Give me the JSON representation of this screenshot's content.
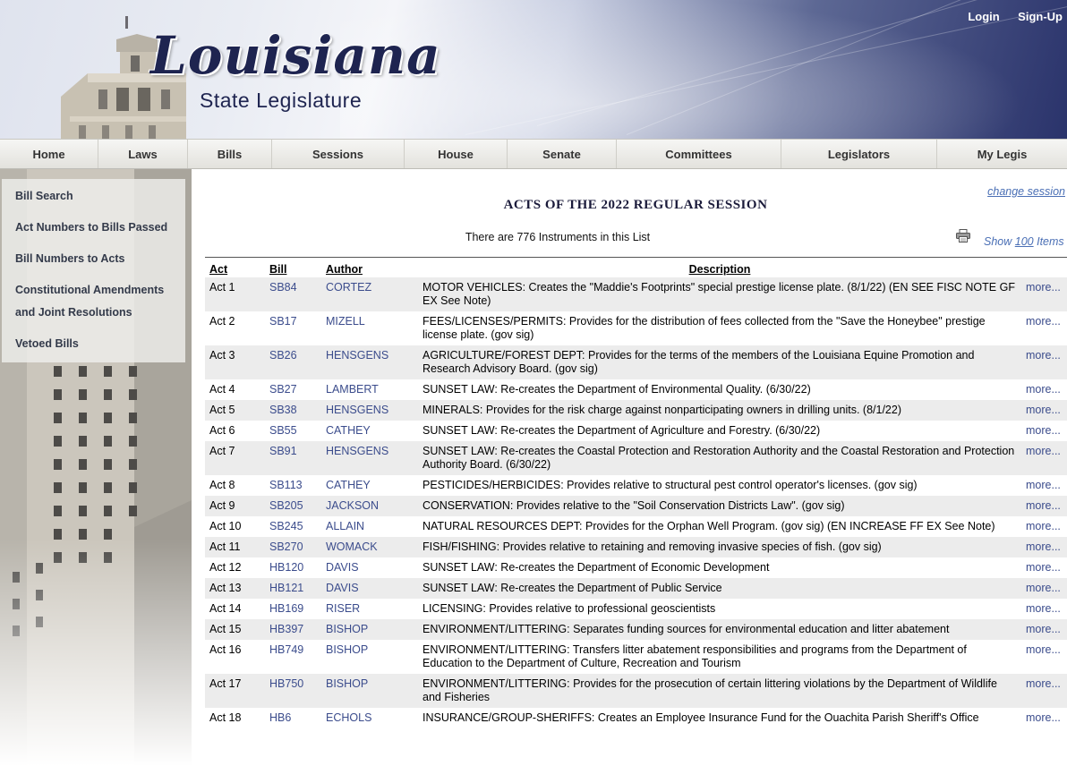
{
  "header": {
    "logo_script": "Louisiana",
    "logo_sub": "State Legislature",
    "login_label": "Login",
    "signup_label": "Sign-Up"
  },
  "nav": {
    "items": [
      "Home",
      "Laws",
      "Bills",
      "Sessions",
      "House",
      "Senate",
      "Committees",
      "Legislators",
      "My Legis"
    ]
  },
  "sidebar": {
    "items": [
      "Bill Search",
      "Act Numbers to Bills Passed",
      "Bill Numbers to Acts",
      "Constitutional Amendments",
      "and Joint Resolutions",
      "Vetoed Bills"
    ]
  },
  "main": {
    "change_session": "change session",
    "title": "ACTS OF THE 2022 REGULAR SESSION",
    "count_text": "There are 776 Instruments in this List",
    "show_prefix": "Show",
    "show_count": "100",
    "show_suffix": "Items",
    "print_icon": "printer-icon"
  },
  "table": {
    "headers": [
      "Act",
      "Bill",
      "Author",
      "Description"
    ],
    "more_label": "more...",
    "rows": [
      {
        "act": "Act 1",
        "bill": "SB84",
        "author": "CORTEZ",
        "desc": "MOTOR VEHICLES:  Creates the \"Maddie's Footprints\" special prestige license plate. (8/1/22) (EN SEE FISC NOTE GF EX See Note)"
      },
      {
        "act": "Act 2",
        "bill": "SB17",
        "author": "MIZELL",
        "desc": "FEES/LICENSES/PERMITS:  Provides for the distribution of fees collected from the \"Save the Honeybee\" prestige license plate. (gov sig)"
      },
      {
        "act": "Act 3",
        "bill": "SB26",
        "author": "HENSGENS",
        "desc": "AGRICULTURE/FOREST DEPT:  Provides for the terms of the members of the Louisiana Equine Promotion and Research Advisory Board. (gov sig)"
      },
      {
        "act": "Act 4",
        "bill": "SB27",
        "author": "LAMBERT",
        "desc": "SUNSET LAW:  Re-creates the Department of Environmental Quality. (6/30/22)"
      },
      {
        "act": "Act 5",
        "bill": "SB38",
        "author": "HENSGENS",
        "desc": "MINERALS:  Provides for the risk charge against nonparticipating owners in drilling units. (8/1/22)"
      },
      {
        "act": "Act 6",
        "bill": "SB55",
        "author": "CATHEY",
        "desc": "SUNSET LAW:  Re-creates the Department of Agriculture and Forestry. (6/30/22)"
      },
      {
        "act": "Act 7",
        "bill": "SB91",
        "author": "HENSGENS",
        "desc": "SUNSET LAW:  Re-creates the Coastal Protection and Restoration Authority and the Coastal Restoration and Protection Authority Board. (6/30/22)"
      },
      {
        "act": "Act 8",
        "bill": "SB113",
        "author": "CATHEY",
        "desc": "PESTICIDES/HERBICIDES:  Provides relative to structural pest control operator's licenses. (gov sig)"
      },
      {
        "act": "Act 9",
        "bill": "SB205",
        "author": "JACKSON",
        "desc": "CONSERVATION:  Provides relative to the \"Soil Conservation Districts Law\". (gov sig)"
      },
      {
        "act": "Act 10",
        "bill": "SB245",
        "author": "ALLAIN",
        "desc": "NATURAL RESOURCES DEPT:  Provides for the Orphan Well Program. (gov sig) (EN INCREASE FF EX See Note)"
      },
      {
        "act": "Act 11",
        "bill": "SB270",
        "author": "WOMACK",
        "desc": "FISH/FISHING:  Provides relative to retaining and removing invasive species of fish. (gov sig)"
      },
      {
        "act": "Act 12",
        "bill": "HB120",
        "author": "DAVIS",
        "desc": "SUNSET LAW:  Re-creates the Department of Economic Development"
      },
      {
        "act": "Act 13",
        "bill": "HB121",
        "author": "DAVIS",
        "desc": "SUNSET LAW:  Re-creates the Department of Public Service"
      },
      {
        "act": "Act 14",
        "bill": "HB169",
        "author": "RISER",
        "desc": "LICENSING:  Provides relative to professional geoscientists"
      },
      {
        "act": "Act 15",
        "bill": "HB397",
        "author": "BISHOP",
        "desc": "ENVIRONMENT/LITTERING:  Separates funding sources for environmental education and litter abatement"
      },
      {
        "act": "Act 16",
        "bill": "HB749",
        "author": "BISHOP",
        "desc": "ENVIRONMENT/LITTERING:  Transfers litter abatement responsibilities and programs from the Department of Education to the Department of Culture, Recreation and Tourism"
      },
      {
        "act": "Act 17",
        "bill": "HB750",
        "author": "BISHOP",
        "desc": "ENVIRONMENT/LITTERING:  Provides for the prosecution of certain littering violations by the Department of Wildlife and Fisheries"
      },
      {
        "act": "Act 18",
        "bill": "HB6",
        "author": "ECHOLS",
        "desc": "INSURANCE/GROUP-SHERIFFS:  Creates an Employee Insurance Fund for the Ouachita Parish Sheriff's Office"
      }
    ]
  }
}
